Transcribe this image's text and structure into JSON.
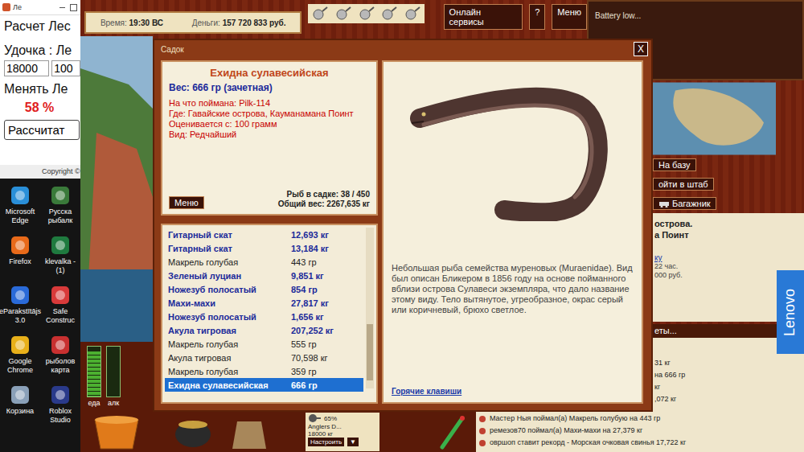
{
  "calculator": {
    "title": "Ле",
    "heading": "Расчет Лес",
    "rod_label": "Удочка : Ле",
    "inputs": [
      "18000",
      "100"
    ],
    "change_label": "Менять Ле",
    "percent": "58 %",
    "button": "Рассчитат",
    "footer": "Copyright ©"
  },
  "desktop_icons": [
    {
      "label": "Microsoft Edge"
    },
    {
      "label": "Русска рыбалк"
    },
    {
      "label": "Firefox"
    },
    {
      "label": "klevalka - (1)"
    },
    {
      "label": "eParakstītājs 3.0"
    },
    {
      "label": "Safe Construc"
    },
    {
      "label": "Google Chrome"
    },
    {
      "label": "рыболов карта"
    },
    {
      "label": "Корзина"
    },
    {
      "label": "Roblox Studio"
    }
  ],
  "top_bar": {
    "time_label": "Время:",
    "time": "19:30 ВС",
    "money_label": "Деньги:",
    "money": "157 720 833 руб.",
    "buttons": [
      "Онлайн сервисы",
      "?",
      "Меню"
    ]
  },
  "status_panel": {
    "text": "Battery low..."
  },
  "dialog": {
    "title": "Садок",
    "close": "X",
    "fish": {
      "name": "Ехидна сулавесийская",
      "weight": "Вес: 666 гр (зачетная)",
      "details": [
        "На что поймана: Pilk-114",
        "Где: Гавайские острова, Кауманамана Поинт",
        "Оценивается с: 100 грамм",
        "Вид: Редчайший"
      ]
    },
    "menu_button": "Меню",
    "count": "Рыб в садке: 38 / 450",
    "total": "Общий вес: 2267,635 кг",
    "rows": [
      {
        "name": "Гитарный скат",
        "weight": "12,693 кг",
        "trophy": true,
        "selected": false
      },
      {
        "name": "Гитарный скат",
        "weight": "13,184 кг",
        "trophy": true,
        "selected": false
      },
      {
        "name": "Макрель голубая",
        "weight": "443 гр",
        "trophy": false,
        "selected": false
      },
      {
        "name": "Зеленый луциан",
        "weight": "9,851 кг",
        "trophy": true,
        "selected": false
      },
      {
        "name": "Ножезуб полосатый",
        "weight": "854 гр",
        "trophy": true,
        "selected": false
      },
      {
        "name": "Махи-махи",
        "weight": "27,817 кг",
        "trophy": true,
        "selected": false
      },
      {
        "name": "Ножезуб полосатый",
        "weight": "1,656 кг",
        "trophy": true,
        "selected": false
      },
      {
        "name": "Акула тигровая",
        "weight": "207,252 кг",
        "trophy": true,
        "selected": false
      },
      {
        "name": "Макрель голубая",
        "weight": "555 гр",
        "trophy": false,
        "selected": false
      },
      {
        "name": "Акула тигровая",
        "weight": "70,598 кг",
        "trophy": false,
        "selected": false
      },
      {
        "name": "Макрель голубая",
        "weight": "359 гр",
        "trophy": false,
        "selected": false
      },
      {
        "name": "Ехидна сулавесийская",
        "weight": "666 гр",
        "trophy": true,
        "selected": true
      }
    ],
    "scroll": {
      "level": 0.92
    },
    "description": "Небольшая рыба семейства муреновых (Muraenidae). Вид был описан Бликером в 1856 году на основе пойманного вблизи острова Сулавеси экземпляра, что дало название этому виду. Тело вытянутое, угреобразное, окрас серый или коричневый, брюхо светлое.",
    "hotkeys": "Горячие клавиши"
  },
  "right_panel": {
    "buttons": [
      "На базу",
      "ойти в штаб",
      "Багажник"
    ],
    "location": [
      "острова.",
      "а Поинт"
    ],
    "link": "ку",
    "lines": [
      "22 час.",
      "000 руб."
    ],
    "header": "еты...",
    "chat_top": [
      "31 кг",
      "на 666 гр",
      "кг",
      ",072 кг"
    ]
  },
  "bottom_bar": {
    "tackle": {
      "name": "Anglers D...",
      "capacity": "18000 кг",
      "wear": "65%",
      "button": "Настроить",
      "dropdown": "▼"
    },
    "chat": [
      "Мастер Ныя поймал(а) Макрель голубую на 443 гр",
      "ремезов70 поймал(а) Махи-махи на 27,379 кг",
      "овршоп ставит рекорд - Морская очковая свинья 17,722 кг"
    ]
  },
  "meters": [
    {
      "label": "еда",
      "level": 0.9
    },
    {
      "label": "алк",
      "level": 0
    }
  ],
  "badge": "Lenovo"
}
